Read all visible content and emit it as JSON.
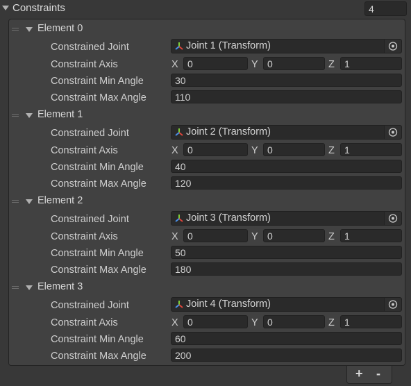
{
  "header": {
    "title": "Constraints",
    "size": "4"
  },
  "elements": [
    {
      "name": "Element 0",
      "joint_label": "Constrained Joint",
      "joint_value": "Joint 1 (Transform)",
      "axis_label": "Constraint Axis",
      "x": "0",
      "y": "0",
      "z": "1",
      "min_label": "Constraint Min Angle",
      "min": "30",
      "max_label": "Constraint Max Angle",
      "max": "110"
    },
    {
      "name": "Element 1",
      "joint_label": "Constrained Joint",
      "joint_value": "Joint 2 (Transform)",
      "axis_label": "Constraint Axis",
      "x": "0",
      "y": "0",
      "z": "1",
      "min_label": "Constraint Min Angle",
      "min": "40",
      "max_label": "Constraint Max Angle",
      "max": "120"
    },
    {
      "name": "Element 2",
      "joint_label": "Constrained Joint",
      "joint_value": "Joint 3 (Transform)",
      "axis_label": "Constraint Axis",
      "x": "0",
      "y": "0",
      "z": "1",
      "min_label": "Constraint Min Angle",
      "min": "50",
      "max_label": "Constraint Max Angle",
      "max": "180"
    },
    {
      "name": "Element 3",
      "joint_label": "Constrained Joint",
      "joint_value": "Joint 4 (Transform)",
      "axis_label": "Constraint Axis",
      "x": "0",
      "y": "0",
      "z": "1",
      "min_label": "Constraint Min Angle",
      "min": "60",
      "max_label": "Constraint Max Angle",
      "max": "200"
    }
  ],
  "axis_letters": {
    "x": "X",
    "y": "Y",
    "z": "Z"
  },
  "footer": {
    "add": "+",
    "remove": "-"
  },
  "icons": {
    "transform": "transform-axes-icon",
    "picker": "object-picker-icon",
    "foldout": "foldout-arrow-icon",
    "drag": "drag-handle-icon"
  },
  "colors": {
    "background": "#383838",
    "panel": "#414141",
    "field": "#2a2a2a",
    "axis_x": "#e0443a",
    "axis_y": "#7fd03a",
    "axis_z": "#4a8fe8"
  }
}
